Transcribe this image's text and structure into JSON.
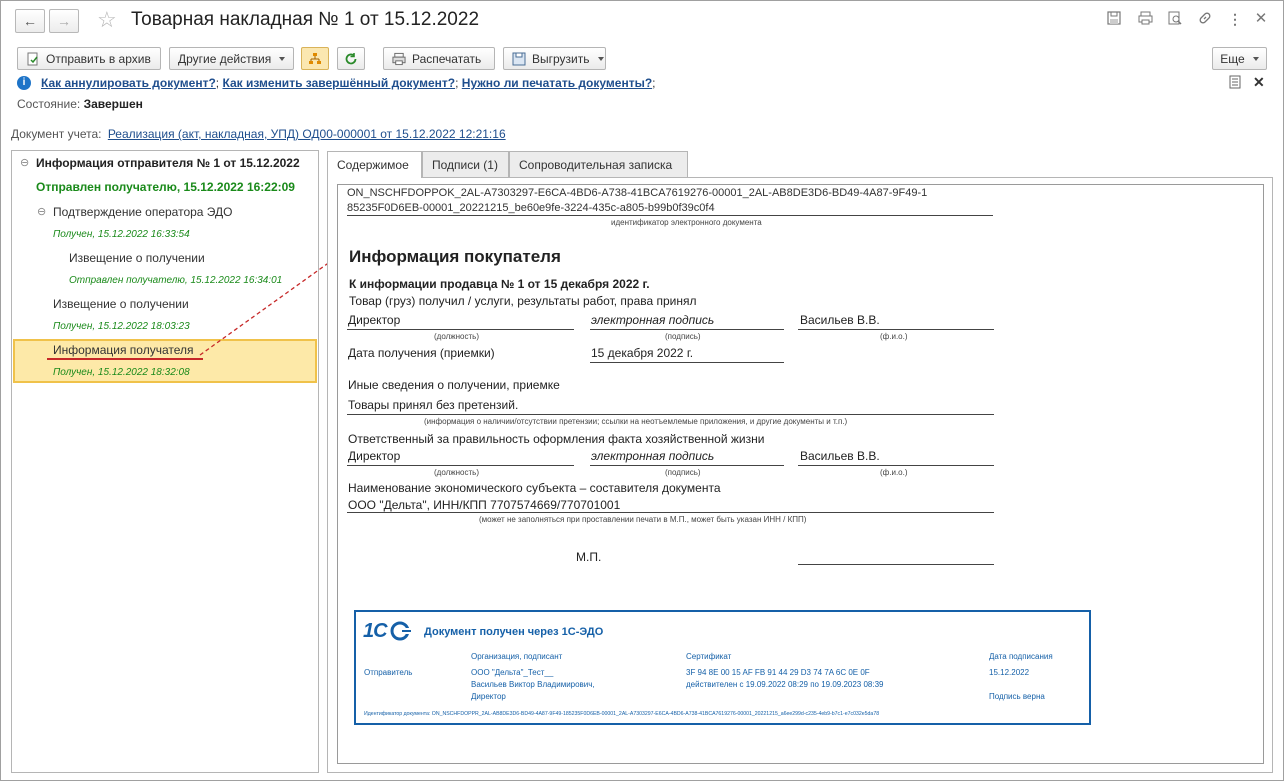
{
  "window": {
    "title": "Товарная накладная № 1 от 15.12.2022"
  },
  "toolbar": {
    "archive": "Отправить в архив",
    "other_actions": "Другие действия",
    "print": "Распечатать",
    "export": "Выгрузить",
    "more": "Еще"
  },
  "help": {
    "link1": "Как аннулировать документ?",
    "link2": "Как изменить завершённый документ?",
    "link3": "Нужно ли печатать документы?",
    "sep": ";"
  },
  "state": {
    "label": "Состояние:",
    "value": "Завершен"
  },
  "account_doc": {
    "label": "Документ учета:",
    "value": "Реализация (акт, накладная, УПД) ОД00-000001 от 15.12.2022 12:21:16"
  },
  "tree": {
    "root": "Информация отправителя № 1 от 15.12.2022",
    "root_status": "Отправлен получателю, 15.12.2022 16:22:09",
    "op_confirm": "Подтверждение оператора ЭДО",
    "op_confirm_status": "Получен, 15.12.2022 16:33:54",
    "notice1": "Извещение о получении",
    "notice1_status": "Отправлен получателю, 15.12.2022 16:34:01",
    "notice2": "Извещение о получении",
    "notice2_status": "Получен, 15.12.2022 18:03:23",
    "recipient_info": "Информация получателя",
    "recipient_info_status": "Получен, 15.12.2022 18:32:08"
  },
  "tabs": [
    "Содержимое",
    "Подписи (1)",
    "Сопроводительная записка"
  ],
  "doc": {
    "id_line1": "ON_NSCHFDOPPOK_2AL-A7303297-E6CA-4BD6-A738-41BCA7619276-00001_2AL-AB8DE3D6-BD49-4A87-9F49-1",
    "id_line2": "85235F0D6EB-00001_20221215_be60e9fe-3224-435c-a805-b99b0f39c0f4",
    "id_caption": "идентификатор электронного документа",
    "heading": "Информация покупателя",
    "subheading": "К информации продавца № 1 от 15 декабря 2022 г.",
    "received_text": "Товар (груз) получил / услуги, результаты работ, права принял",
    "position": "Директор",
    "signature": "электронная подпись",
    "name": "Васильев В.В.",
    "cap_position": "(должность)",
    "cap_signature": "(подпись)",
    "cap_name": "(ф.и.о.)",
    "date_label": "Дата получения (приемки)",
    "date_value": "15 декабря 2022 г.",
    "other_info": "Иные сведения о получении, приемке",
    "other_value": "Товары принял без претензий.",
    "other_caption": "(информация о наличии/отсутствии претензии; ссылки на неотъемлемые приложения, и другие  документы и т.п.)",
    "responsible": "Ответственный за правильность оформления факта хозяйственной жизни",
    "position2": "Директор",
    "signature2": "электронная подпись",
    "name2": "Васильев В.В.",
    "entity_label": "Наименование экономического субъекта – составителя документа",
    "entity_value": "ООО \"Дельта\", ИНН/КПП 7707574669/770701001",
    "entity_caption": "(может не заполняться при проставлении печати в М.П., может быть указан ИНН / КПП)",
    "mp": "М.П."
  },
  "stamp": {
    "logo": "1С",
    "title": "Документ получен через 1С-ЭДО",
    "col_org": "Организация, подписант",
    "col_cert": "Сертификат",
    "col_date": "Дата подписания",
    "role": "Отправитель",
    "org1": "ООО \"Дельта\"_Тест__",
    "org2": "Васильев  Виктор  Владимирович,",
    "org3": "Директор",
    "cert1": "3F 94 8E 00 15 AF FB 91 44 29 D3 74 7A 6C 0E 0F",
    "cert2": "действителен с 19.09.2022 08:29 по 19.09.2023 08:39",
    "date": "15.12.2022",
    "verified": "Подпись верна",
    "id_line": "Идентификатор документа: ON_NSCHFDOPPR_2AL-AB8DE3D6-BD49-4A87-9F49-185235F0D6EB-00001_2AL-A7303297-E6CA-4BD6-A738-41BCA7619276-00001_20221215_a6ee299d-c235-4eb9-b7c1-e7c032e5da78"
  },
  "colors": {
    "accent_green": "#1a8a1a",
    "highlight": "#fde9a8",
    "stamp_blue": "#1560a8",
    "arrow_red": "#c62828"
  }
}
